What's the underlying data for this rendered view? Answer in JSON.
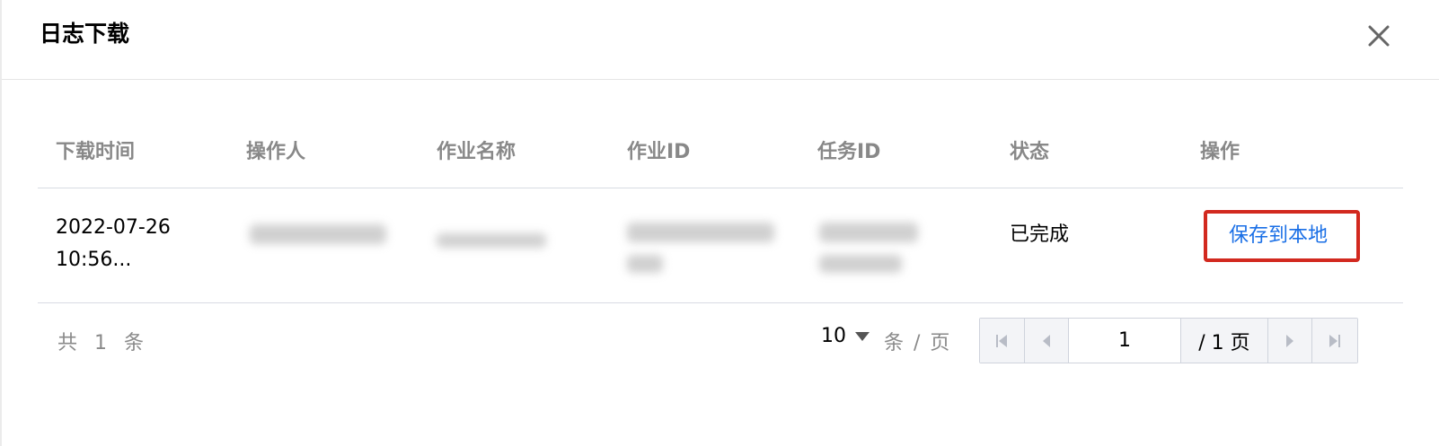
{
  "dialog": {
    "title": "日志下载"
  },
  "table": {
    "columns": [
      "下载时间",
      "操作人",
      "作业名称",
      "作业ID",
      "任务ID",
      "状态",
      "操作"
    ],
    "rows": [
      {
        "download_time_line1": "2022-07-26",
        "download_time_line2": "10:56...",
        "status": "已完成",
        "action": "保存到本地"
      }
    ]
  },
  "footer": {
    "total": "共 1 条",
    "page_size": "10",
    "per_page": "条 / 页",
    "current_page": "1",
    "total_pages": "/ 1 页"
  },
  "colors": {
    "highlight_border": "#d2291f",
    "link": "#1a6fe6",
    "header_text": "#888888"
  },
  "icons": {
    "close": "close-icon",
    "first": "first-page-icon",
    "prev": "prev-page-icon",
    "next": "next-page-icon",
    "last": "last-page-icon"
  }
}
